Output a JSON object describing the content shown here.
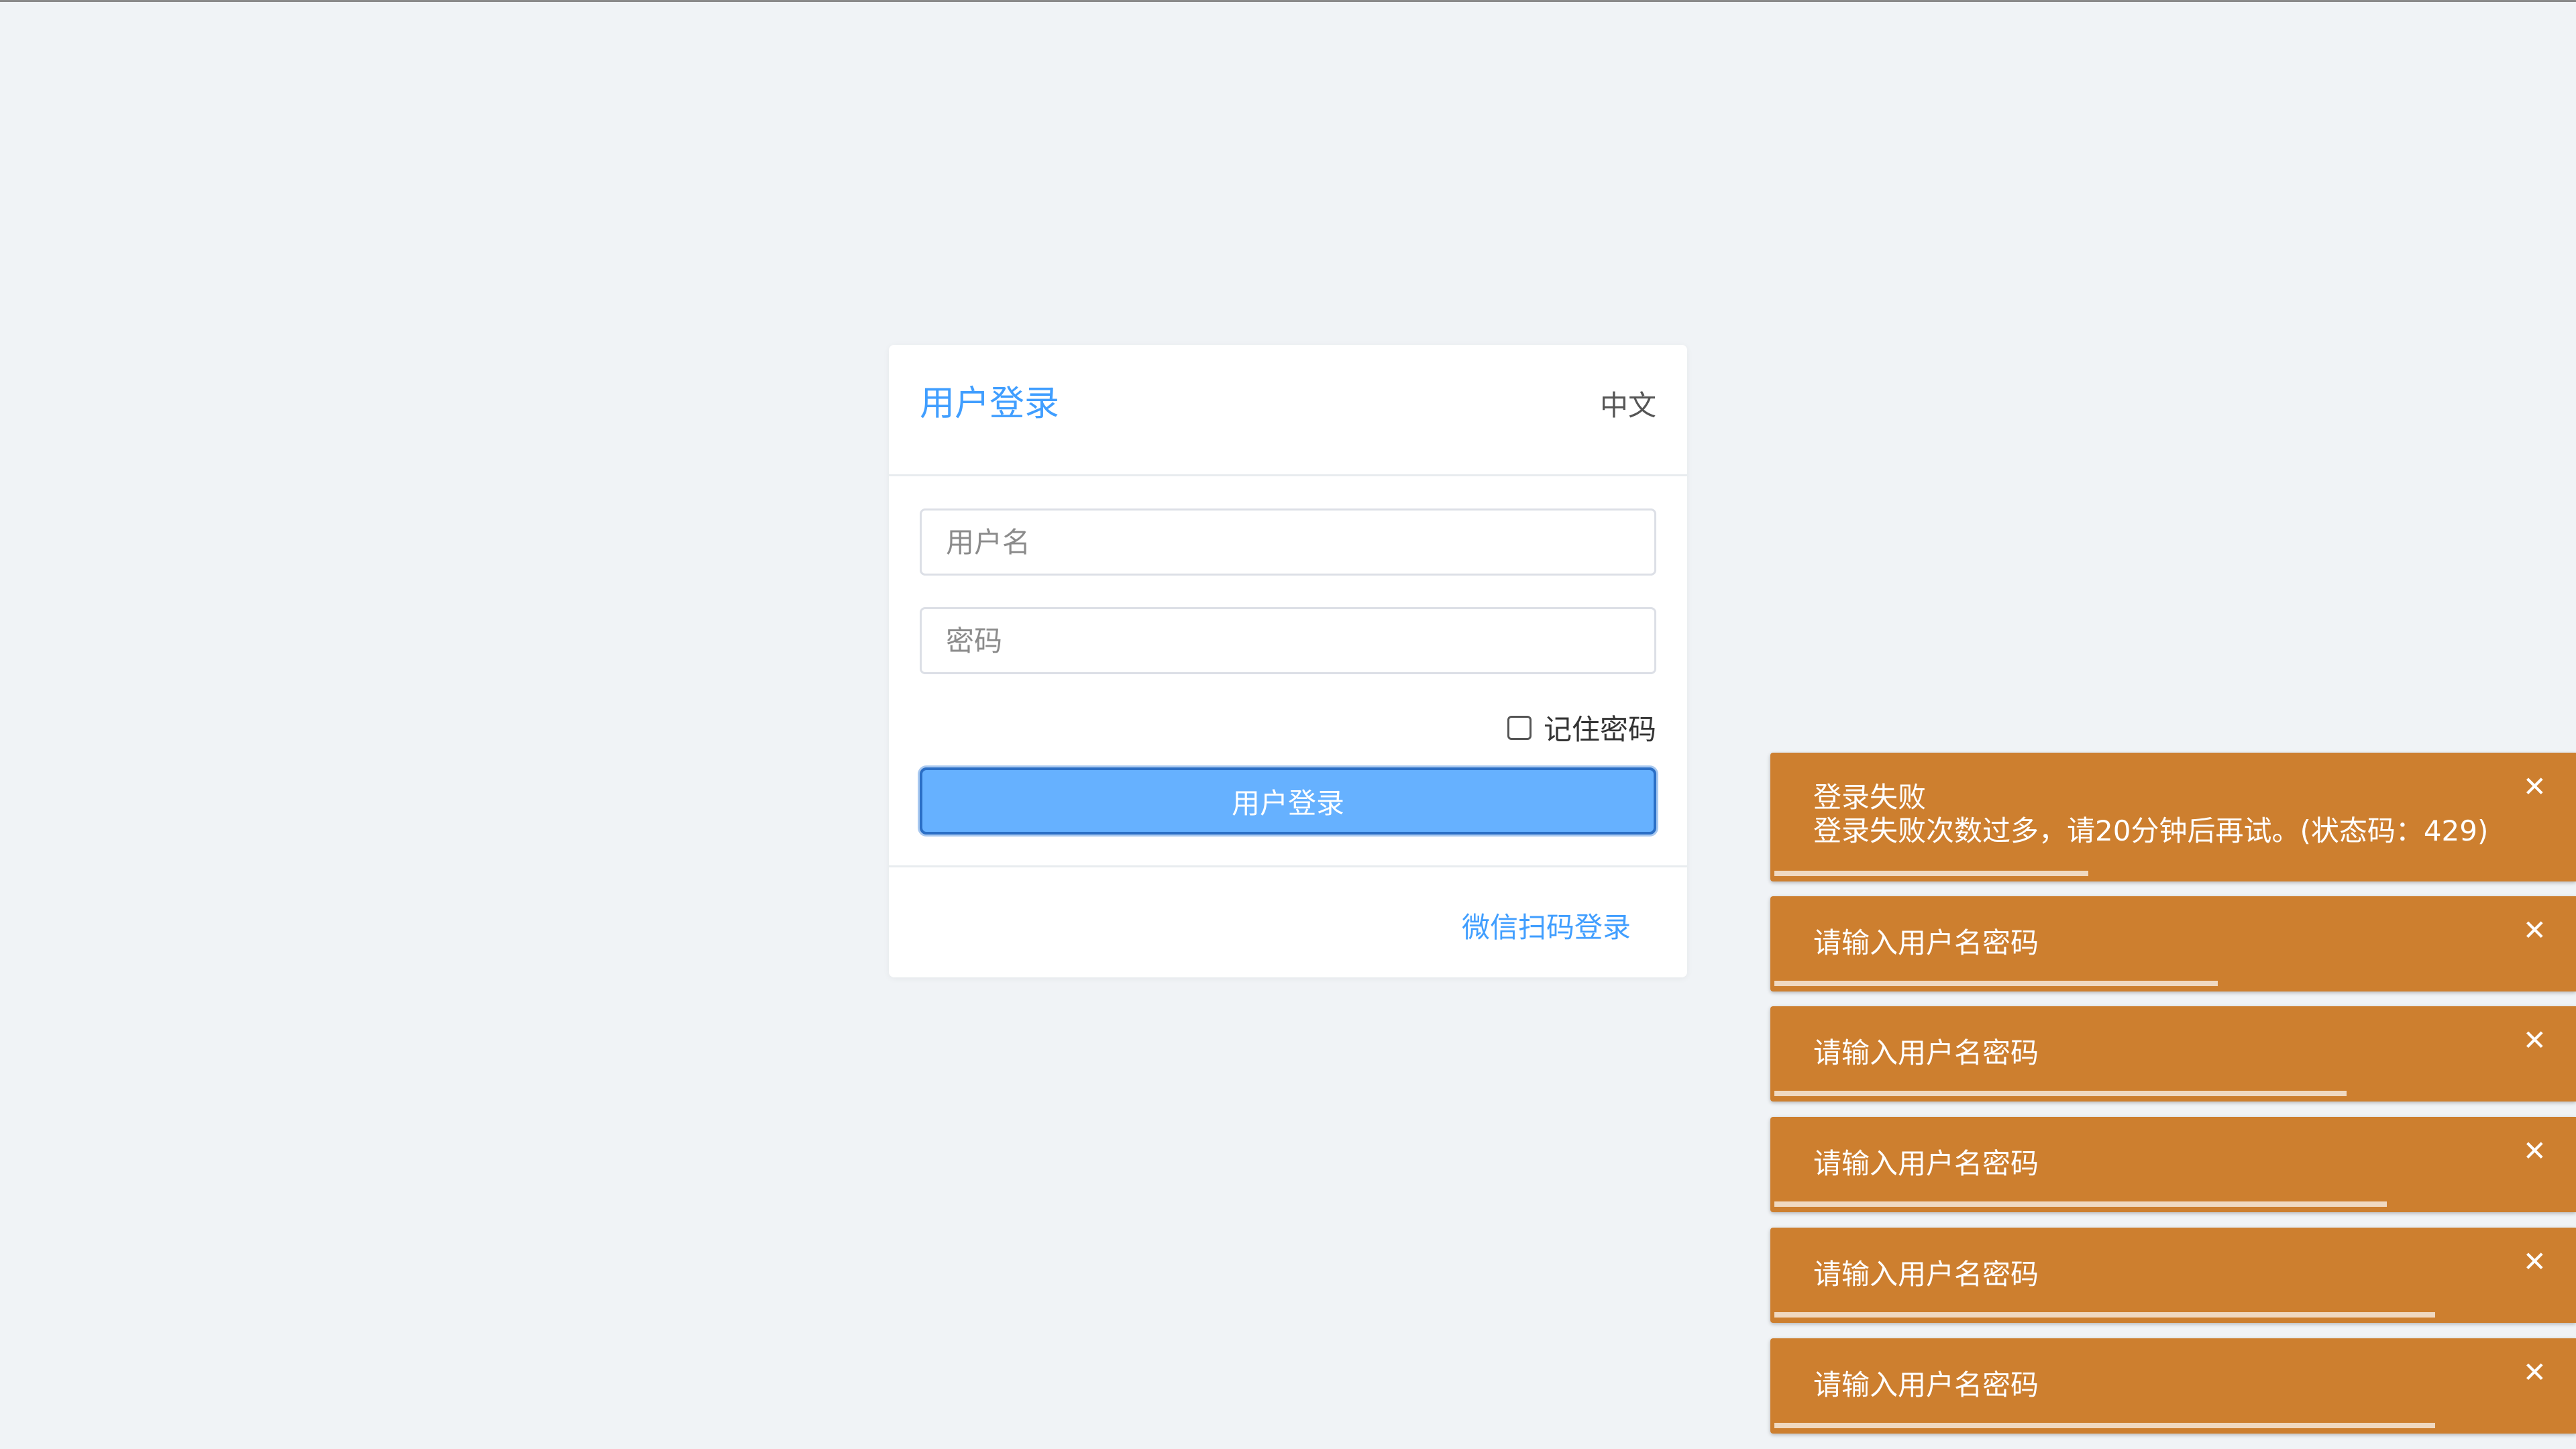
{
  "login": {
    "title": "用户登录",
    "language": "中文",
    "username_placeholder": "用户名",
    "password_placeholder": "密码",
    "remember_label": "记住密码",
    "remember_checked": false,
    "submit_label": "用户登录",
    "wechat_link": "微信扫码登录"
  },
  "colors": {
    "accent": "#409eff",
    "button": "#66b1ff",
    "toast": "#cd7f2f",
    "background": "#f0f3f6"
  },
  "toasts": [
    {
      "title": "登录失败",
      "message": "登录失败次数过多，请20分钟后再试。(状态码：429)",
      "progress": 0.39,
      "close_icon": "close-icon"
    },
    {
      "message": "请输入用户名密码",
      "progress": 0.55,
      "close_icon": "close-icon"
    },
    {
      "message": "请输入用户名密码",
      "progress": 0.71,
      "close_icon": "close-icon"
    },
    {
      "message": "请输入用户名密码",
      "progress": 0.76,
      "close_icon": "close-icon"
    },
    {
      "message": "请输入用户名密码",
      "progress": 0.82,
      "close_icon": "close-icon"
    },
    {
      "message": "请输入用户名密码",
      "progress": 0.82,
      "close_icon": "close-icon"
    }
  ]
}
